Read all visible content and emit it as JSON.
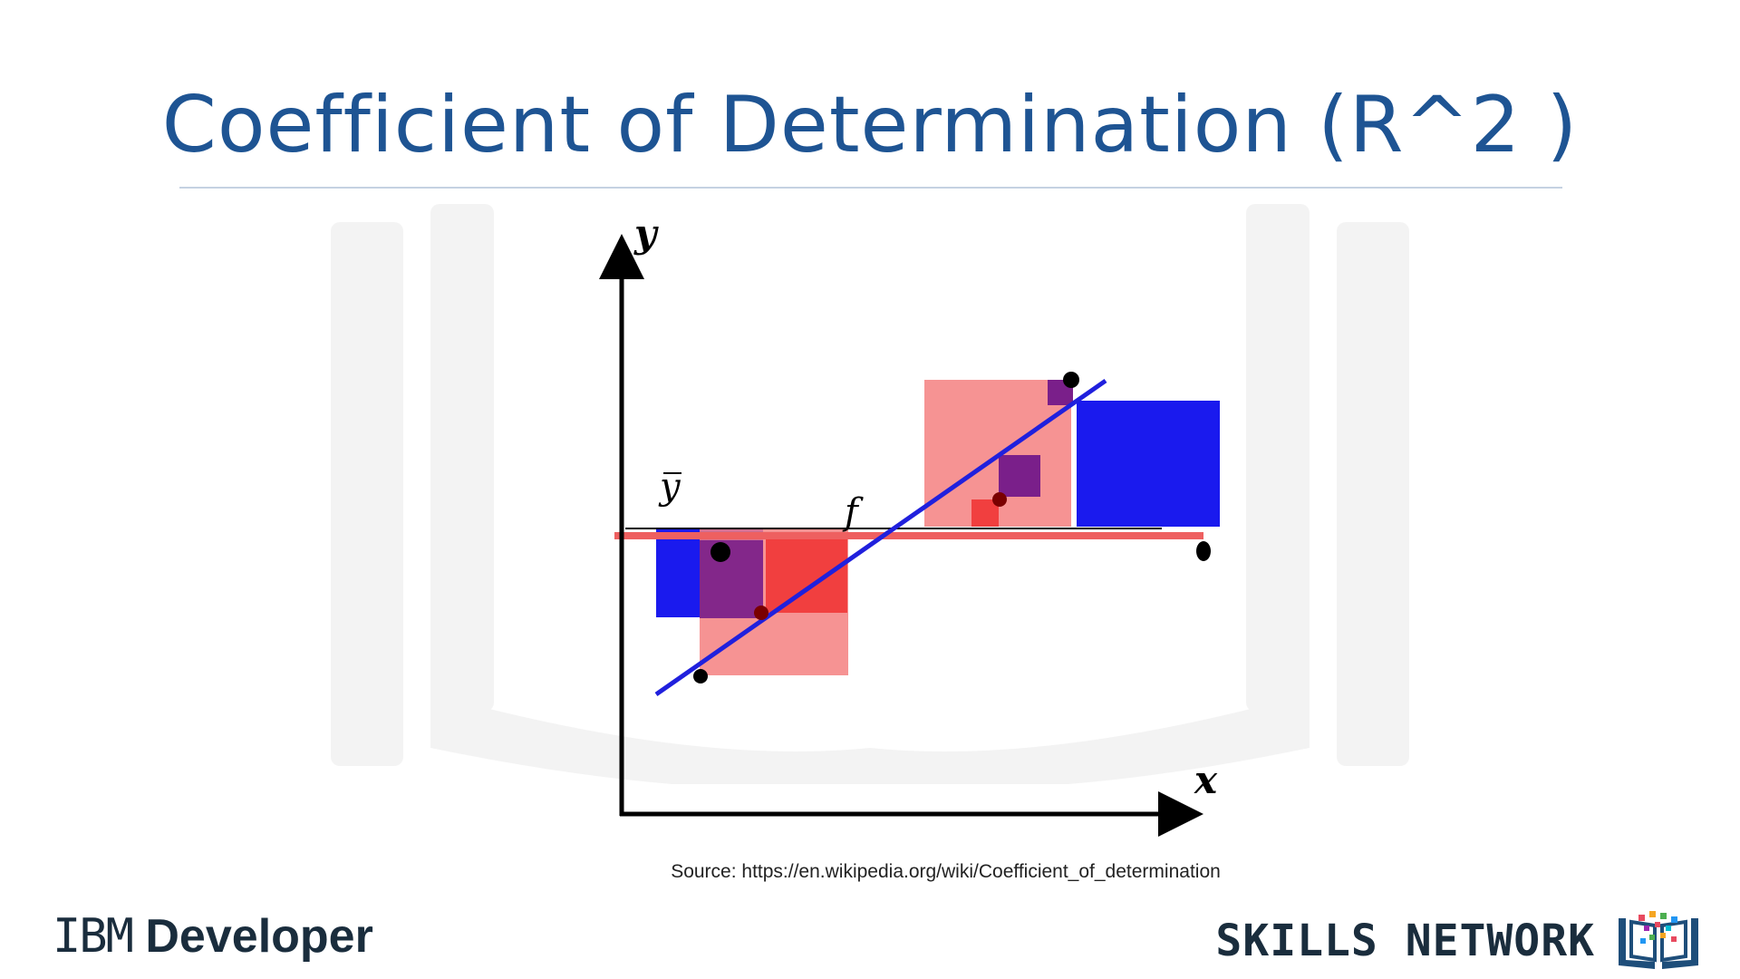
{
  "slide": {
    "title": "Coefficient of Determination (R^2 )",
    "source": "Source: https://en.wikipedia.org/wiki/Coefficient_of_determination"
  },
  "diagram": {
    "y_axis_label": "y",
    "x_axis_label": "x",
    "mean_label": "y",
    "fit_label": "f",
    "colors": {
      "axis": "#000000",
      "mean_line": "#ee6060",
      "fit_line": "#2020dd",
      "total_square": "#1a1aee",
      "residual_square_light": "#f58080",
      "residual_square_strong": "#f03030",
      "overlap_square": "#7a1f8a",
      "point": "#000000"
    }
  },
  "branding": {
    "left_prefix": "IBM",
    "left_name": "Developer",
    "right_name": "SKILLS NETWORK",
    "logo_icon": "open-book-icon"
  }
}
